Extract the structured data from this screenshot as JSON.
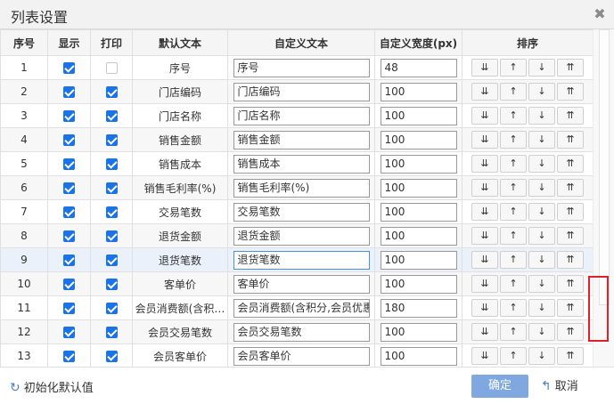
{
  "dialog": {
    "title": "列表设置",
    "close_icon": "✖"
  },
  "columns": {
    "seq": "序号",
    "show": "显示",
    "print": "打印",
    "default_text": "默认文本",
    "custom_text": "自定义文本",
    "custom_width": "自定义宽度(px)",
    "sort": "排序"
  },
  "sort_buttons": {
    "bottom": "⇊",
    "down": "↓",
    "up": "↑",
    "top": "⇈"
  },
  "rows": [
    {
      "seq": "1",
      "show": true,
      "print": false,
      "default_text": "序号",
      "custom_text": "序号",
      "width": "48"
    },
    {
      "seq": "2",
      "show": true,
      "print": true,
      "default_text": "门店编码",
      "custom_text": "门店编码",
      "width": "100"
    },
    {
      "seq": "3",
      "show": true,
      "print": true,
      "default_text": "门店名称",
      "custom_text": "门店名称",
      "width": "100"
    },
    {
      "seq": "4",
      "show": true,
      "print": true,
      "default_text": "销售金额",
      "custom_text": "销售金额",
      "width": "100"
    },
    {
      "seq": "5",
      "show": true,
      "print": true,
      "default_text": "销售成本",
      "custom_text": "销售成本",
      "width": "100"
    },
    {
      "seq": "6",
      "show": true,
      "print": true,
      "default_text": "销售毛利率(%)",
      "custom_text": "销售毛利率(%)",
      "width": "100"
    },
    {
      "seq": "7",
      "show": true,
      "print": true,
      "default_text": "交易笔数",
      "custom_text": "交易笔数",
      "width": "100"
    },
    {
      "seq": "8",
      "show": true,
      "print": true,
      "default_text": "退货金额",
      "custom_text": "退货金额",
      "width": "100"
    },
    {
      "seq": "9",
      "show": true,
      "print": true,
      "default_text": "退货笔数",
      "custom_text": "退货笔数",
      "width": "100",
      "highlight": true
    },
    {
      "seq": "10",
      "show": true,
      "print": true,
      "default_text": "客单价",
      "custom_text": "客单价",
      "width": "100"
    },
    {
      "seq": "11",
      "show": true,
      "print": true,
      "default_text": "会员消费额(含积…",
      "custom_text": "会员消费额(含积分,会员优惠",
      "width": "180"
    },
    {
      "seq": "12",
      "show": true,
      "print": true,
      "default_text": "会员交易笔数",
      "custom_text": "会员交易笔数",
      "width": "100"
    },
    {
      "seq": "13",
      "show": true,
      "print": true,
      "default_text": "会员客单价",
      "custom_text": "会员客单价",
      "width": "100"
    }
  ],
  "footer": {
    "reset_icon": "↻",
    "reset_label": "初始化默认值",
    "ok_label": "确定",
    "cancel_icon": "↰",
    "cancel_label": "取消"
  },
  "colors": {
    "checkbox_on": "#1a73e8",
    "ok_button": "#7fa8e0",
    "highlight_row": "#eaf1fb",
    "scroll_marker": "#e0202a"
  }
}
